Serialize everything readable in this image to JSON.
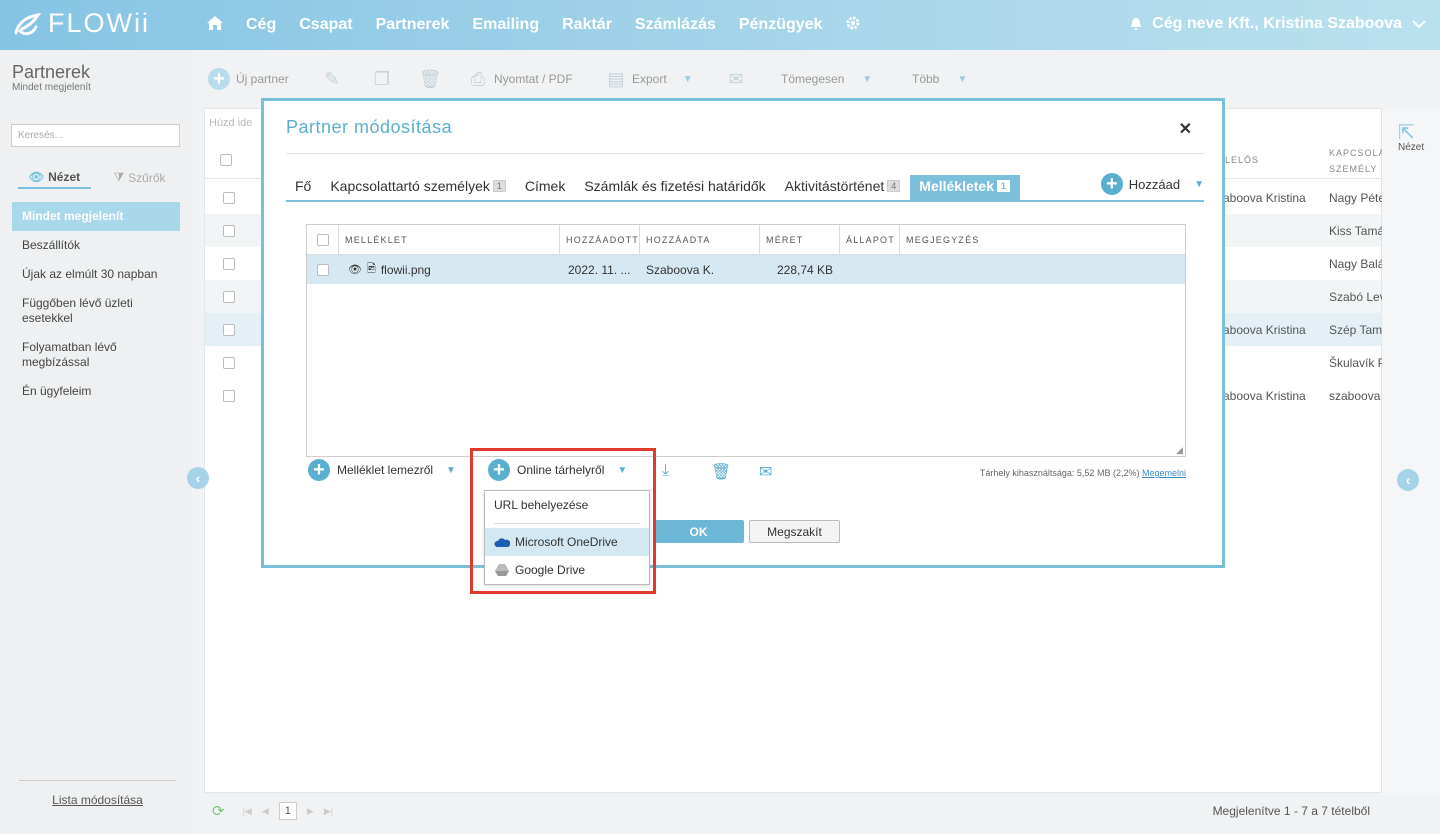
{
  "brand": {
    "name": "FLOWii"
  },
  "nav": {
    "items": [
      "Cég",
      "Csapat",
      "Partnerek",
      "Emailing",
      "Raktár",
      "Számlázás",
      "Pénzügyek"
    ],
    "user": "Cég neve Kft., Kristina Szaboova"
  },
  "page": {
    "title": "Partnerek",
    "subtitle": "Mindet megjelenít"
  },
  "sidebar": {
    "search_placeholder": "Keresés...",
    "view_tab": "Nézet",
    "filter_tab": "Szűrők",
    "items": [
      "Mindet megjelenít",
      "Beszállítók",
      "Újak az elmúlt 30 napban",
      "Függőben lévő üzleti esetekkel",
      "Folyamatban lévő megbízással",
      "Én ügyfeleim"
    ],
    "list_edit": "Lista módosítása"
  },
  "toolbar": {
    "new_partner": "Új partner",
    "print": "Nyomtat / PDF",
    "export": "Export",
    "bulk": "Tömegesen",
    "more": "Több"
  },
  "grid": {
    "group_hint": "Húzd ide",
    "col_owner": "FELELŐS",
    "col_contact": "KAPCSOLATTARTÓ SZEMÉLY",
    "rows": [
      {
        "owner": "Szaboova Kristina",
        "contact": "Nagy Péter"
      },
      {
        "owner": "",
        "contact": "Kiss Tamás"
      },
      {
        "owner": "",
        "contact": "Nagy Balázs"
      },
      {
        "owner": "",
        "contact": "Szabó Levente"
      },
      {
        "owner": "Szaboova Kristina",
        "contact": "Szép Tamás"
      },
      {
        "owner": "",
        "contact": "Škulavík P"
      },
      {
        "owner": "Szaboova Kristina",
        "contact": "szaboova"
      }
    ],
    "page": "1",
    "footer": "Megjelenítve 1 - 7 a 7 tételből"
  },
  "right_panel": {
    "label": "Nézet"
  },
  "modal": {
    "title": "Partner módosítása",
    "tabs": [
      {
        "label": "Fő",
        "badge": ""
      },
      {
        "label": "Kapcsolattartó személyek",
        "badge": "1"
      },
      {
        "label": "Címek",
        "badge": ""
      },
      {
        "label": "Számlák és fizetési határidők",
        "badge": ""
      },
      {
        "label": "Aktivitástörténet",
        "badge": "4"
      },
      {
        "label": "Mellékletek",
        "badge": "1"
      }
    ],
    "add": "Hozzáad",
    "columns": [
      "MELLÉKLET",
      "HOZZÁADOTT",
      "HOZZÁADTA",
      "MÉRET",
      "ÁLLAPOT",
      "MEGJEGYZÉS"
    ],
    "attachment": {
      "name": "flowii.png",
      "added": "2022. 11. ...",
      "added_by": "Szaboova K.",
      "size": "228,74 KB"
    },
    "from_disk": "Melléklet lemezről",
    "online": "Online tárhelyről",
    "storage_text": "Tárhely kihasználtsága: 5,52 MB (2,2%)",
    "upgrade": "Megemelni",
    "ok": "OK",
    "cancel": "Megszakít",
    "dropdown": [
      "URL behelyezése",
      "Microsoft OneDrive",
      "Google Drive"
    ]
  }
}
